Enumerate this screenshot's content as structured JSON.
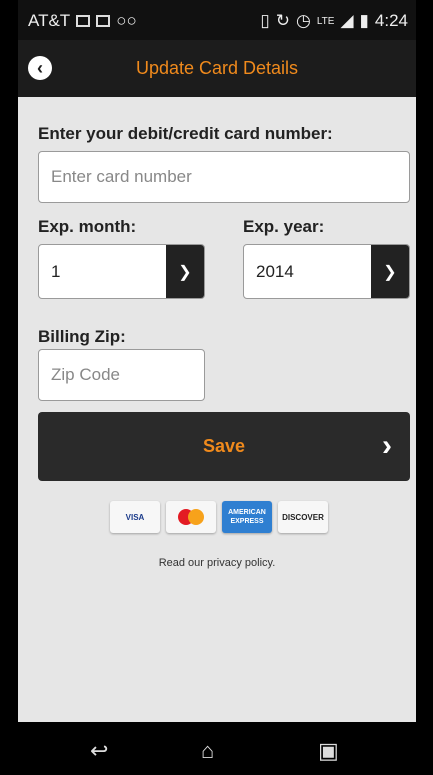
{
  "status_bar": {
    "carrier": "AT&T",
    "network": "LTE",
    "time": "4:24"
  },
  "header": {
    "title": "Update Card Details"
  },
  "form": {
    "card_label": "Enter your debit/credit card number:",
    "card_placeholder": "Enter card number",
    "exp_month_label": "Exp. month:",
    "exp_month_value": "1",
    "exp_year_label": "Exp. year:",
    "exp_year_value": "2014",
    "zip_label": "Billing Zip:",
    "zip_placeholder": "Zip Code",
    "save_label": "Save"
  },
  "card_logos": {
    "visa": "VISA",
    "amex_line1": "AMERICAN",
    "amex_line2": "EXPRESS",
    "discover": "DISCOVER"
  },
  "privacy_text": "Read our privacy policy.",
  "colors": {
    "accent": "#f08a1c",
    "bar": "#1c1c1c",
    "background": "#e6e6e6"
  }
}
